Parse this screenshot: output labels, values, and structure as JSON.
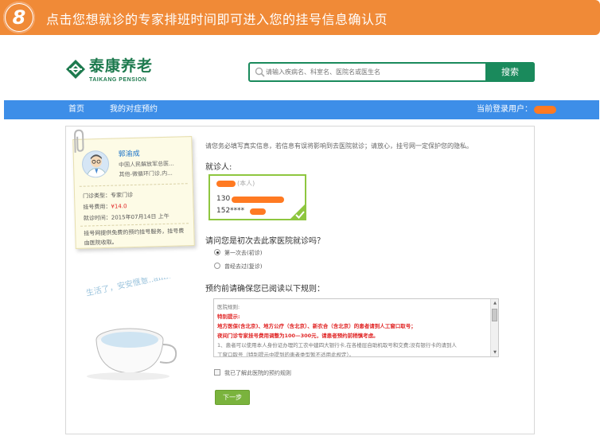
{
  "banner": {
    "step": "8",
    "text": "点击您想就诊的专家排班时间即可进入您的挂号信息确认页"
  },
  "brand": {
    "name_cn": "泰康养老",
    "name_en": "TAIKANG PENSION"
  },
  "search": {
    "placeholder": "请输入疾病名、科室名、医院名或医生名",
    "button": "搜索"
  },
  "nav": {
    "items": [
      "首页",
      "我的对症预约"
    ],
    "login_label": "当前登录用户："
  },
  "doctor_card": {
    "name": "郭渝成",
    "hospital": "中国人民解放军总医...",
    "dept": "其他-微循环门诊,内...",
    "clinic_type": "门诊类型：专家门诊",
    "fee_label": "挂号费用：",
    "fee_value": "¥14.0",
    "visit_time": "就诊时间：2015年07月14日  上午",
    "note": "挂号网提供免费的预约挂号服务，挂号费由医院收取。",
    "doodle_text": "生活了，安安惬意..ahh!"
  },
  "form": {
    "info": "请您务必填写真实信息，若信息有误将影响到去医院就诊；请放心，挂号网一定保护您的隐私。",
    "patient_label": "就诊人:",
    "patient_self": "(本人)",
    "phone1_prefix": "130",
    "phone2_prefix": "152****",
    "first_visit_question": "请问您是初次去此家医院就诊吗？",
    "options": [
      "第一次去(初诊)",
      "曾经去过(复诊)"
    ],
    "selected_option": 0,
    "rules_title": "预约前请确保您已阅读以下规则：",
    "rules": [
      {
        "text": "医院规则:",
        "style": "gray"
      },
      {
        "text": "特别提示:",
        "style": "red"
      },
      {
        "text": "地方医保(含北京)、地方公疗（含北京）、新农合（含北京）的患者请到人工窗口取号；",
        "style": "red"
      },
      {
        "text": "夜间门诊专家挂号费用调整为100—300元，请患者预约前稍慎考虑。",
        "style": "red"
      },
      {
        "text": "1、患者可以使用本人身份证办理的工农中建四大银行卡,在各楼层自助机取号和交费;没有银行卡的请到人",
        "style": "gray"
      },
      {
        "text": "工窗口取号（特别提示中提到的患者类型暂不适用此规定）。",
        "style": "gray"
      }
    ],
    "agree_label": "我已了解此医院的预约规则",
    "next_button": "下一步"
  },
  "colors": {
    "banner": "#f08a37",
    "brand_green": "#1a8a5c",
    "nav_blue": "#3d8ee8",
    "patient_border": "#8ec63f",
    "next_button": "#7ab33d",
    "alert_red": "#e02424"
  }
}
